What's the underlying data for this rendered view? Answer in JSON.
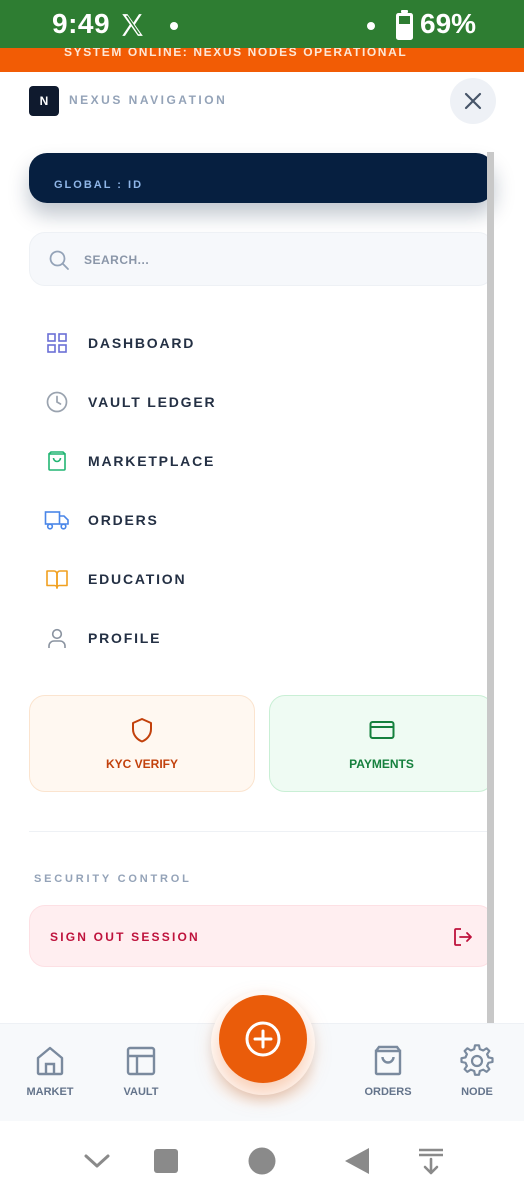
{
  "status_bar": {
    "time": "9:49",
    "battery": "69%",
    "background": "#2e7d32"
  },
  "banner": {
    "text": "SYSTEM ONLINE: NEXUS NODES OPERATIONAL",
    "background": "#f25c05"
  },
  "header": {
    "logo_letter": "N",
    "title": "NEXUS NAVIGATION"
  },
  "id_card": {
    "label": "GLOBAL : ID",
    "background": "#061f40"
  },
  "search": {
    "placeholder": "SEARCH..."
  },
  "menu": {
    "items": [
      {
        "label": "DASHBOARD",
        "icon": "grid-icon",
        "color": "#6b6fd6"
      },
      {
        "label": "VAULT LEDGER",
        "icon": "clock-icon",
        "color": "#9aa3af"
      },
      {
        "label": "MARKETPLACE",
        "icon": "shopping-bag-icon",
        "color": "#22b573"
      },
      {
        "label": "ORDERS",
        "icon": "truck-icon",
        "color": "#4a86e8"
      },
      {
        "label": "EDUCATION",
        "icon": "book-icon",
        "color": "#f0a020"
      },
      {
        "label": "PROFILE",
        "icon": "user-icon",
        "color": "#8a93a0"
      }
    ]
  },
  "cards": {
    "kyc": {
      "label": "KYC VERIFY",
      "icon": "shield-icon",
      "color": "#c2410c"
    },
    "payments": {
      "label": "PAYMENTS",
      "icon": "credit-card-icon",
      "color": "#15803d"
    }
  },
  "security": {
    "section_label": "SECURITY CONTROL",
    "sign_out_label": "SIGN OUT SESSION",
    "icon": "logout-icon"
  },
  "bottom_nav": {
    "items": [
      {
        "label": "MARKET",
        "icon": "home-icon"
      },
      {
        "label": "VAULT",
        "icon": "layout-icon"
      },
      {
        "label": "ORDERS",
        "icon": "shopping-bag-icon"
      },
      {
        "label": "NODE",
        "icon": "gear-icon"
      }
    ],
    "fab_icon": "plus-circle-icon",
    "accent": "#ea5c0a"
  }
}
